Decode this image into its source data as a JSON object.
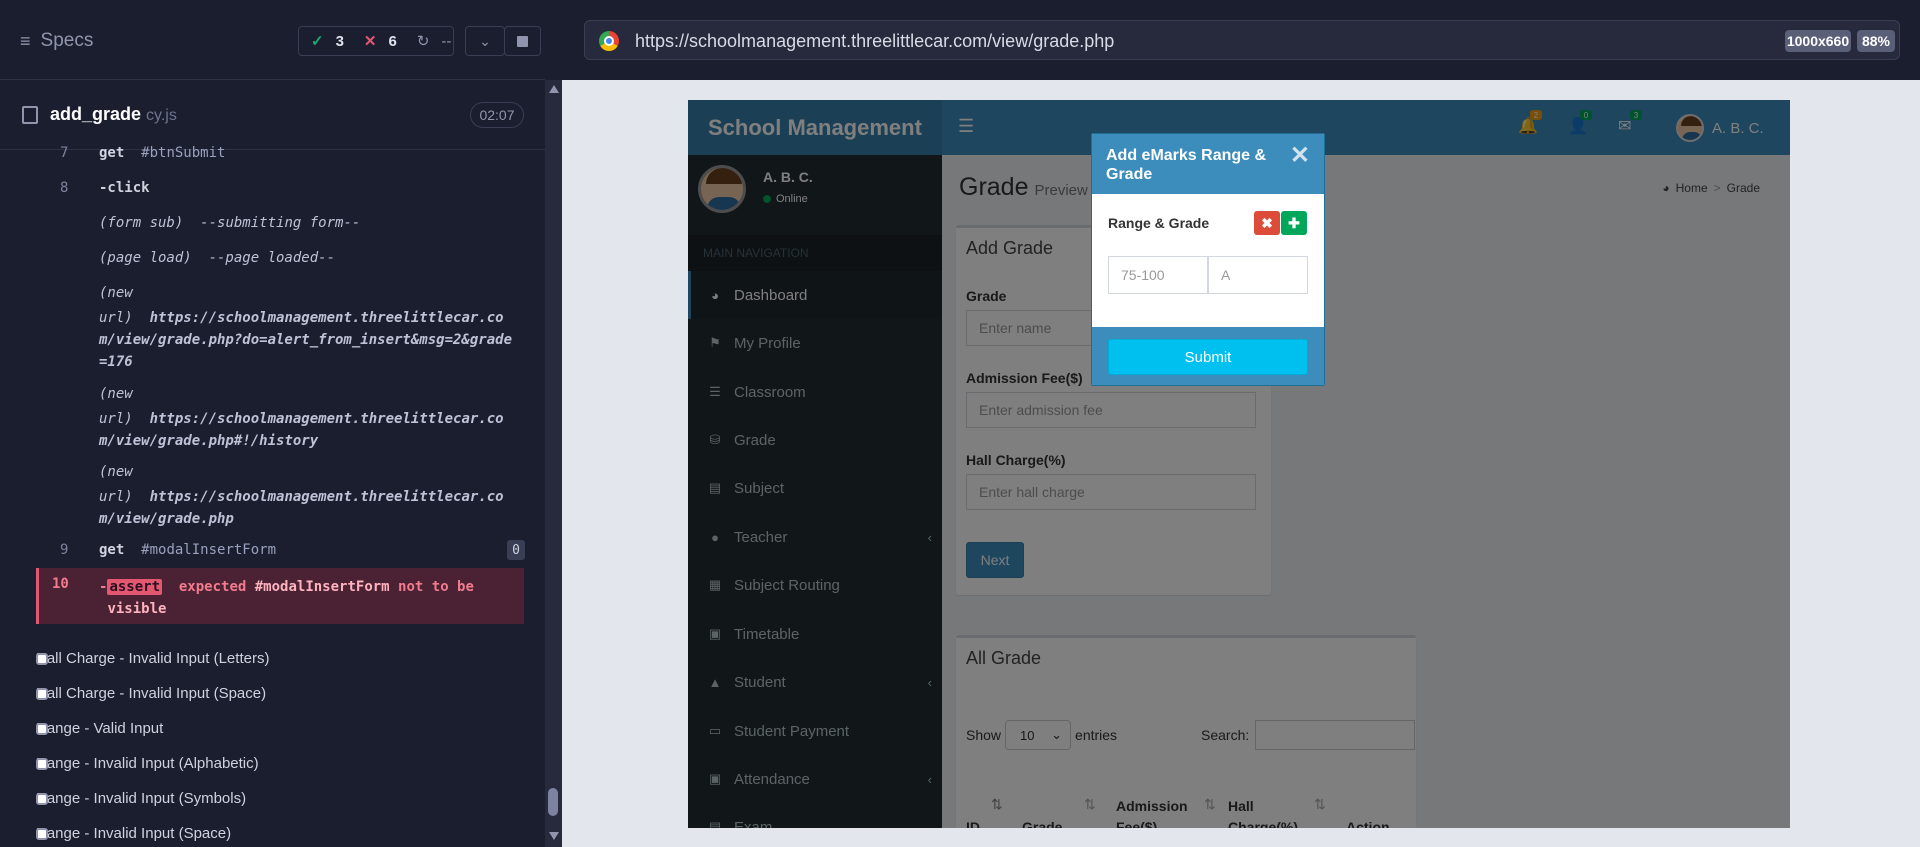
{
  "reporter": {
    "specs_label": "Specs",
    "stats": {
      "passed": "3",
      "failed": "6",
      "pending": "--"
    },
    "spec": {
      "name": "add_grade",
      "ext": "cy.js",
      "duration": "02:07"
    },
    "commands": [
      {
        "num": "7",
        "name": "get",
        "arg": "#btnSubmit"
      },
      {
        "num": "8",
        "name": "-click",
        "arg": ""
      },
      {
        "event": "(form sub)",
        "text": "--submitting form--"
      },
      {
        "event": "(page load)",
        "text": "--page loaded--"
      },
      {
        "event": "(new",
        "line2": "url)",
        "url": "https://schoolmanagement.threelittlecar.com/view/grade.php?do=alert_from_insert&msg=2&grade=176"
      },
      {
        "event": "(new",
        "line2": "url)",
        "url": "https://schoolmanagement.threelittlecar.com/view/grade.php#!/history"
      },
      {
        "event": "(new",
        "line2": "url)",
        "url": "https://schoolmanagement.threelittlecar.com/view/grade.php"
      },
      {
        "num": "9",
        "name": "get",
        "arg": "#modalInsertForm",
        "badge": "0"
      }
    ],
    "failed_command": {
      "num": "10",
      "dash": "-",
      "tag": "assert",
      "msg_a": "expected",
      "selector": "#modalInsertForm",
      "msg_b": "not to be",
      "msg_c": "visible"
    },
    "tests": [
      "Hall Charge - Invalid Input (Letters)",
      "Hall Charge - Invalid Input (Space)",
      "Range - Valid Input",
      "Range - Invalid Input (Alphabetic)",
      "Range - Invalid Input (Symbols)",
      "Range - Invalid Input (Space)"
    ]
  },
  "browser": {
    "url": "https://schoolmanagement.threelittlecar.com/view/grade.php",
    "viewport": "1000x660",
    "zoom": "88%"
  },
  "app": {
    "logo": "School Management",
    "header_badges": {
      "notifications": "2",
      "users": "0",
      "messages": "3"
    },
    "user_name": "A. B. C.",
    "user_status": "Online",
    "nav_header": "MAIN NAVIGATION",
    "nav": [
      {
        "label": "Dashboard",
        "icon": "dashboard-icon"
      },
      {
        "label": "My Profile",
        "icon": "flag-icon"
      },
      {
        "label": "Classroom",
        "icon": "list-icon"
      },
      {
        "label": "Grade",
        "icon": "database-icon"
      },
      {
        "label": "Subject",
        "icon": "book-icon"
      },
      {
        "label": "Teacher",
        "icon": "user-icon",
        "chevron": true
      },
      {
        "label": "Subject Routing",
        "icon": "grid-icon"
      },
      {
        "label": "Timetable",
        "icon": "calendar-icon"
      },
      {
        "label": "Student",
        "icon": "graduation-cap-icon",
        "chevron": true
      },
      {
        "label": "Student Payment",
        "icon": "money-icon"
      },
      {
        "label": "Attendance",
        "icon": "calendar-check-icon",
        "chevron": true
      },
      {
        "label": "Exam",
        "icon": "exam-icon"
      }
    ],
    "page_title": "Grade",
    "page_subtitle": "Preview",
    "breadcrumb": {
      "home": "Home",
      "current": "Grade"
    },
    "add_form": {
      "title": "Add Grade",
      "grade_label": "Grade",
      "grade_placeholder": "Enter name",
      "fee_label": "Admission Fee($)",
      "fee_placeholder": "Enter admission fee",
      "hall_label": "Hall Charge(%)",
      "hall_placeholder": "Enter hall charge",
      "next": "Next"
    },
    "table": {
      "title": "All Grade",
      "show": "Show",
      "entries_value": "10",
      "entries": "entries",
      "search": "Search:",
      "columns": [
        [
          "",
          "ID"
        ],
        [
          "",
          "Grade"
        ],
        [
          "Admission",
          "Fee($)"
        ],
        [
          "Hall",
          "Charge(%)"
        ],
        [
          "",
          "Action"
        ]
      ]
    },
    "modal": {
      "title": "Add eMarks Range & Grade",
      "label": "Range & Grade",
      "range_placeholder": "75-100",
      "grade_placeholder": "A",
      "submit": "Submit"
    }
  }
}
